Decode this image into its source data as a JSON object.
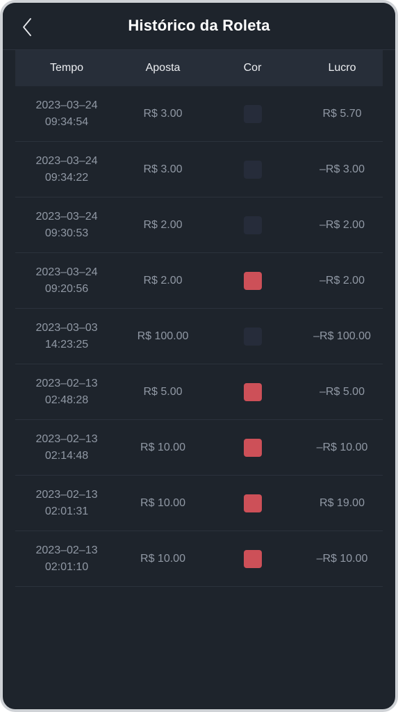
{
  "header": {
    "title": "Histórico da Roleta",
    "back_icon": "chevron-left-icon"
  },
  "table": {
    "columns": [
      {
        "key": "tempo",
        "label": "Tempo"
      },
      {
        "key": "aposta",
        "label": "Aposta"
      },
      {
        "key": "cor",
        "label": "Cor"
      },
      {
        "key": "lucro",
        "label": "Lucro"
      }
    ],
    "rows": [
      {
        "tempo": "2023–03–24 09:34:54",
        "aposta": "R$ 3.00",
        "cor": "black",
        "cor_hex": "#262c3a",
        "lucro": "R$ 5.70",
        "lucro_sign": "positive"
      },
      {
        "tempo": "2023–03–24 09:34:22",
        "aposta": "R$ 3.00",
        "cor": "black",
        "cor_hex": "#262c3a",
        "lucro": "–R$ 3.00",
        "lucro_sign": "negative"
      },
      {
        "tempo": "2023–03–24 09:30:53",
        "aposta": "R$ 2.00",
        "cor": "black",
        "cor_hex": "#262c3a",
        "lucro": "–R$ 2.00",
        "lucro_sign": "negative"
      },
      {
        "tempo": "2023–03–24 09:20:56",
        "aposta": "R$ 2.00",
        "cor": "red",
        "cor_hex": "#cd5058",
        "lucro": "–R$ 2.00",
        "lucro_sign": "negative"
      },
      {
        "tempo": "2023–03–03 14:23:25",
        "aposta": "R$ 100.00",
        "cor": "black",
        "cor_hex": "#262c3a",
        "lucro": "–R$ 100.00",
        "lucro_sign": "negative"
      },
      {
        "tempo": "2023–02–13 02:48:28",
        "aposta": "R$ 5.00",
        "cor": "red",
        "cor_hex": "#cd5058",
        "lucro": "–R$ 5.00",
        "lucro_sign": "negative"
      },
      {
        "tempo": "2023–02–13 02:14:48",
        "aposta": "R$ 10.00",
        "cor": "red",
        "cor_hex": "#cd5058",
        "lucro": "–R$ 10.00",
        "lucro_sign": "negative"
      },
      {
        "tempo": "2023–02–13 02:01:31",
        "aposta": "R$ 10.00",
        "cor": "red",
        "cor_hex": "#cd5058",
        "lucro": "R$ 19.00",
        "lucro_sign": "positive"
      },
      {
        "tempo": "2023–02–13 02:01:10",
        "aposta": "R$ 10.00",
        "cor": "red",
        "cor_hex": "#cd5058",
        "lucro": "–R$ 10.00",
        "lucro_sign": "negative"
      }
    ]
  },
  "theme": {
    "background": "#1e242c",
    "header_band": "#272e39",
    "row_divider": "#2b323c",
    "text_muted": "#9199a5",
    "text_bright": "#eceef1",
    "profit_positive": "#2fd14a",
    "profit_negative": "#cc4a52",
    "swatch_black": "#262c3a",
    "swatch_red": "#cd5058",
    "frame_border": "#cfd2d6"
  }
}
